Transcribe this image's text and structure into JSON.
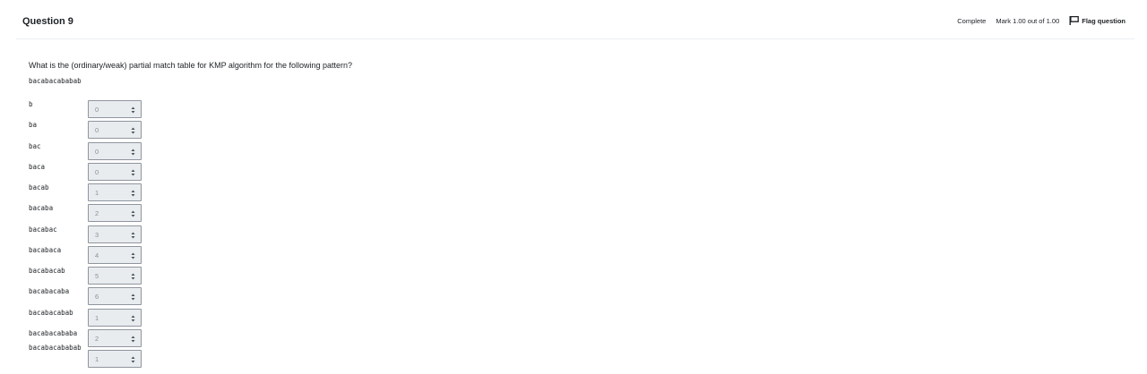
{
  "question": {
    "title": "Question 9",
    "state": "Complete",
    "grade": "Mark 1.00 out of 1.00",
    "flag_label": "Flag question",
    "text": "What is the (ordinary/weak) partial match table for KMP algorithm for the following pattern?",
    "pattern": "bacabacababab"
  },
  "rows": [
    {
      "label": "b",
      "value": "0"
    },
    {
      "label": "ba",
      "value": "0"
    },
    {
      "label": "bac",
      "value": "0"
    },
    {
      "label": "baca",
      "value": "0"
    },
    {
      "label": "bacab",
      "value": "1"
    },
    {
      "label": "bacaba",
      "value": "2"
    },
    {
      "label": "bacabac",
      "value": "3"
    },
    {
      "label": "bacabaca",
      "value": "4"
    },
    {
      "label": "bacabacab",
      "value": "5"
    },
    {
      "label": "bacabacaba",
      "value": "6"
    },
    {
      "label": "bacabacabab",
      "value": "1"
    },
    {
      "label": "bacabacababa",
      "value": "2"
    },
    {
      "label": "bacabacababab",
      "value": "1"
    }
  ],
  "icons": {
    "flag": "flag-icon",
    "select_arrows": "sort-arrows-icon"
  },
  "colors": {
    "select_bg": "#e9ecef",
    "select_border": "#8f959e",
    "select_text": "#8a9096"
  }
}
